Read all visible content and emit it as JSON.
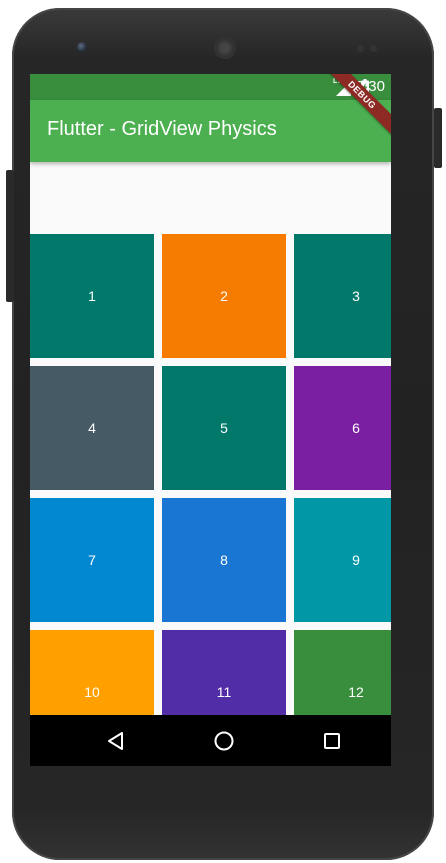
{
  "status_bar": {
    "time": "7:30",
    "network_label": "LTE",
    "icons": [
      "lte-signal-icon",
      "battery-charging-icon"
    ],
    "color": "#388E3C"
  },
  "app_bar": {
    "title": "Flutter - GridView Physics",
    "color": "#4CAF50"
  },
  "debug_banner": {
    "label": "DEBUG",
    "color": "#8D2A24"
  },
  "grid": {
    "columns": 3,
    "items": [
      {
        "label": "1",
        "color": "#00796B"
      },
      {
        "label": "2",
        "color": "#F57C00"
      },
      {
        "label": "3",
        "color": "#00796B"
      },
      {
        "label": "4",
        "color": "#455A64"
      },
      {
        "label": "5",
        "color": "#00796B"
      },
      {
        "label": "6",
        "color": "#7B1FA2"
      },
      {
        "label": "7",
        "color": "#0288D1"
      },
      {
        "label": "8",
        "color": "#1976D2"
      },
      {
        "label": "9",
        "color": "#0097A7"
      },
      {
        "label": "10",
        "color": "#FFA000"
      },
      {
        "label": "11",
        "color": "#512DA8"
      },
      {
        "label": "12",
        "color": "#388E3C"
      }
    ]
  },
  "nav_bar": {
    "buttons": [
      {
        "name": "back-icon"
      },
      {
        "name": "home-icon"
      },
      {
        "name": "recents-icon"
      }
    ]
  }
}
